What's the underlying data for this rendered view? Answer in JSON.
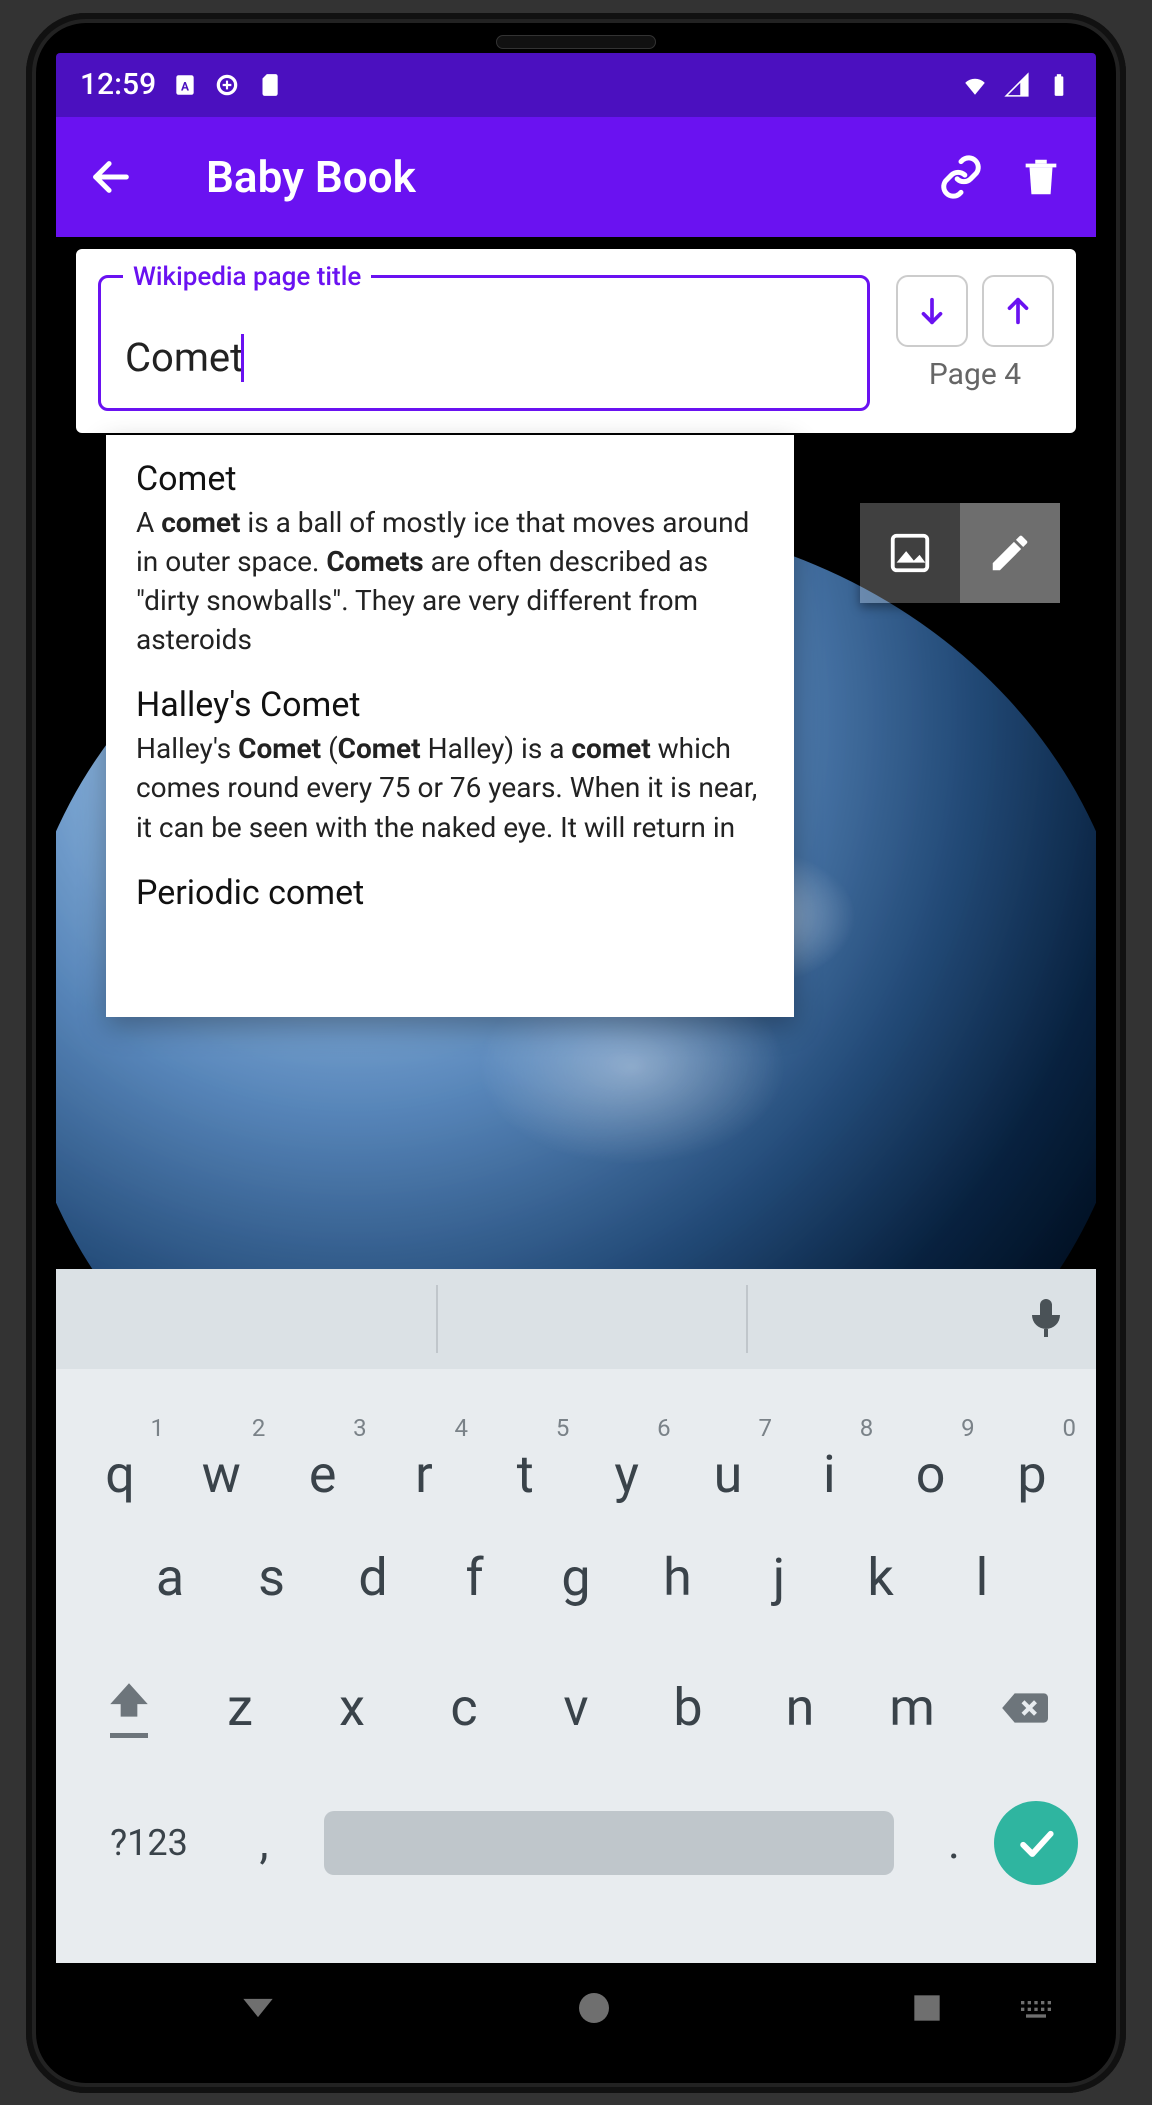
{
  "statusbar": {
    "time": "12:59"
  },
  "appbar": {
    "title": "Baby Book"
  },
  "search": {
    "label": "Wikipedia page title",
    "value": "Comet",
    "page_label": "Page 4"
  },
  "suggestions": [
    {
      "title": "Comet",
      "desc_parts": [
        "A ",
        "comet",
        " is a ball of mostly ice that moves around in outer space. ",
        "Comets",
        " are often described as \"dirty snowballs\". They are very different from asteroids"
      ]
    },
    {
      "title": "Halley's Comet",
      "desc_parts": [
        "Halley's ",
        "Comet",
        " (",
        "Comet",
        " Halley) is a ",
        "comet",
        " which comes round every 75 or 76 years. When it is near, it can be seen with the naked eye. It will return in"
      ]
    },
    {
      "title": "Periodic comet",
      "desc_parts": []
    }
  ],
  "keyboard": {
    "rows": {
      "top": [
        {
          "num": "1",
          "ch": "q"
        },
        {
          "num": "2",
          "ch": "w"
        },
        {
          "num": "3",
          "ch": "e"
        },
        {
          "num": "4",
          "ch": "r"
        },
        {
          "num": "5",
          "ch": "t"
        },
        {
          "num": "6",
          "ch": "y"
        },
        {
          "num": "7",
          "ch": "u"
        },
        {
          "num": "8",
          "ch": "i"
        },
        {
          "num": "9",
          "ch": "o"
        },
        {
          "num": "0",
          "ch": "p"
        }
      ],
      "mid": [
        "a",
        "s",
        "d",
        "f",
        "g",
        "h",
        "j",
        "k",
        "l"
      ],
      "bot": [
        "z",
        "x",
        "c",
        "v",
        "b",
        "n",
        "m"
      ]
    },
    "symbols_label": "?123",
    "comma": ",",
    "dot": "."
  }
}
